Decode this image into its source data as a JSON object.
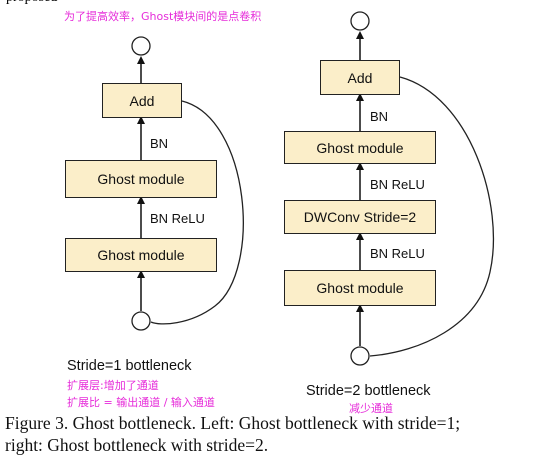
{
  "top_partial_text": "proposed",
  "annotations": {
    "top_note": "为了提高效率，Ghost模块间的是点卷积",
    "expand_layer": "扩展层:增加了通道",
    "expand_ratio": "扩展比 = 输出通道 / 输入通道",
    "reduce_channels": "减少通道"
  },
  "left_block": {
    "title": "Stride=1 bottleneck",
    "add_label": "Add",
    "module_top_label": "Ghost module",
    "module_bottom_label": "Ghost module",
    "bn_label": "BN",
    "bn_relu_label": "BN ReLU"
  },
  "right_block": {
    "title": "Stride=2 bottleneck",
    "add_label": "Add",
    "module_top_label": "Ghost module",
    "dwconv_label": "DWConv Stride=2",
    "module_bottom_label": "Ghost module",
    "bn_label": "BN",
    "bn_relu_label_1": "BN ReLU",
    "bn_relu_label_2": "BN ReLU"
  },
  "caption": {
    "line1": "Figure 3. Ghost bottleneck. Left: Ghost bottleneck with stride=1;",
    "line2": "right: Ghost bottleneck with stride=2."
  },
  "colors": {
    "box_fill": "#fbeec9",
    "annotation": "#e62bd9",
    "line": "#222222"
  }
}
